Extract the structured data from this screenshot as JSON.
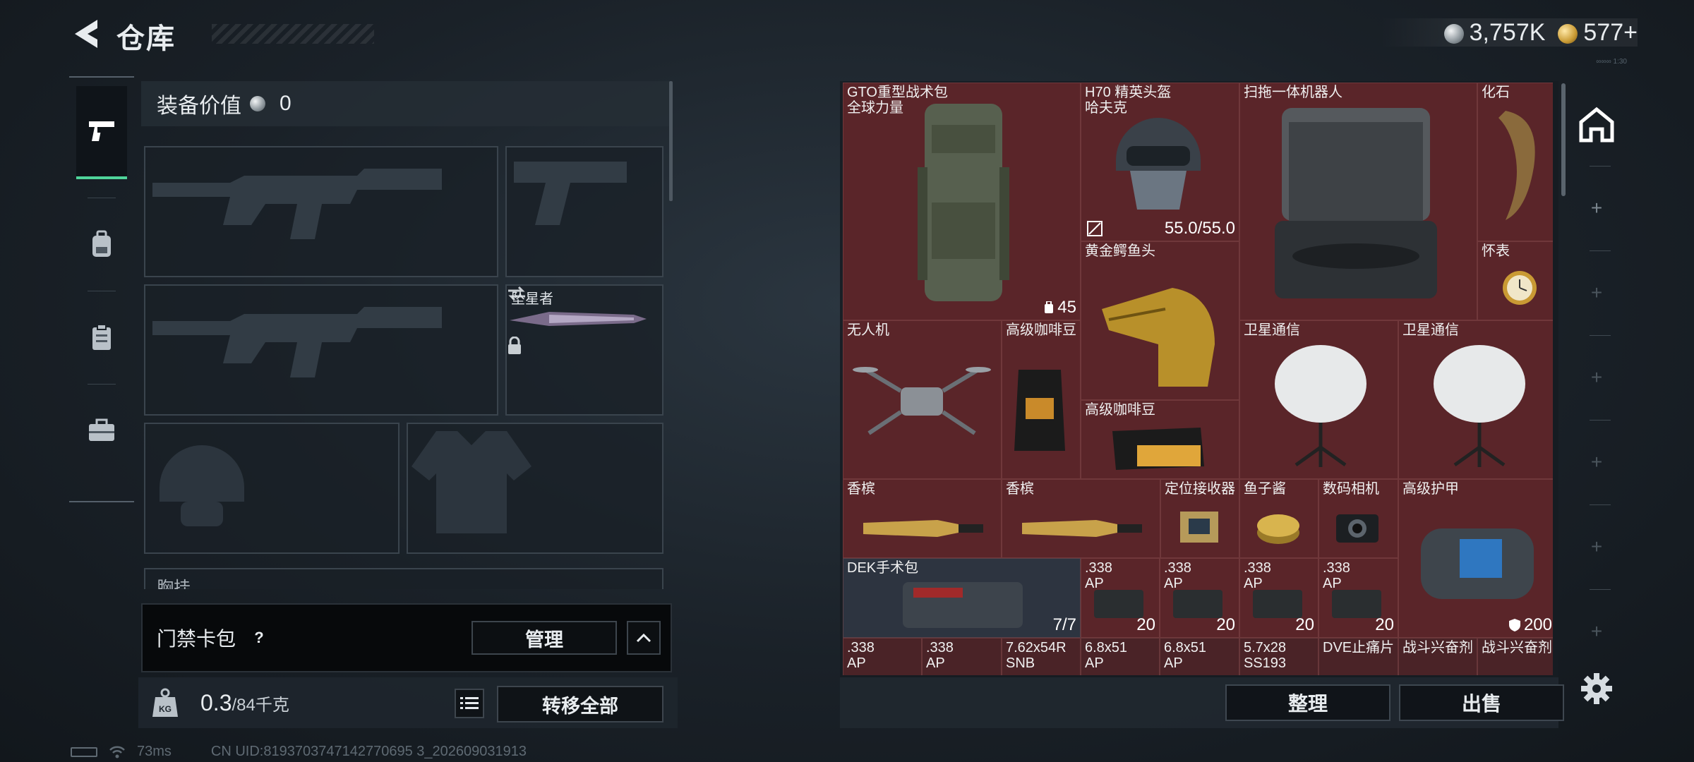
{
  "header": {
    "title": "仓库",
    "currency": [
      {
        "icon": "silver-coin-icon",
        "value": "3,757K"
      },
      {
        "icon": "gold-coin-icon",
        "value": "577+"
      }
    ],
    "tiny_text": "∞∞∞ 1:30"
  },
  "left_nav": [
    {
      "icon": "pistol-icon",
      "active": true
    },
    {
      "icon": "backpack-icon",
      "active": false
    },
    {
      "icon": "clipboard-icon",
      "active": false
    },
    {
      "icon": "briefcase-icon",
      "active": false
    }
  ],
  "equipment": {
    "value_label": "装备价值",
    "value": "0",
    "melee_name": "坠星者",
    "next_section": "胸挂"
  },
  "card_pack": {
    "title": "门禁卡包",
    "help": "?",
    "manage_label": "管理"
  },
  "weight": {
    "current": "0.3",
    "max": "/84千克",
    "icon_text": "KG",
    "transfer_label": "转移全部"
  },
  "status_bar": {
    "ping": "73ms",
    "uid": "CN UID:8193703747142770695 3_202609031913"
  },
  "warehouse_items": [
    {
      "name": "GTO重型战术包\n全球力量",
      "badge": "45"
    },
    {
      "name": "H70 精英头盔\n哈夫克",
      "badge": "55.0/55.0"
    },
    {
      "name": "扫拖一体机器人",
      "badge": ""
    },
    {
      "name": "化石",
      "badge": ""
    },
    {
      "name": "黄金鳄鱼头",
      "badge": ""
    },
    {
      "name": "怀表",
      "badge": ""
    },
    {
      "name": "无人机",
      "badge": ""
    },
    {
      "name": "高级咖啡豆",
      "badge": ""
    },
    {
      "name": "卫星通信",
      "badge": ""
    },
    {
      "name": "卫星通信",
      "badge": ""
    },
    {
      "name": "高级咖啡豆",
      "badge": ""
    },
    {
      "name": "香槟",
      "badge": ""
    },
    {
      "name": "香槟",
      "badge": ""
    },
    {
      "name": "定位接收器",
      "badge": ""
    },
    {
      "name": "鱼子酱",
      "badge": ""
    },
    {
      "name": "数码相机",
      "badge": ""
    },
    {
      "name": "高级护甲",
      "badge": "200"
    },
    {
      "name": "DEK手术包",
      "badge": "7/7"
    },
    {
      "name": ".338\nAP",
      "badge": "20"
    },
    {
      "name": ".338\nAP",
      "badge": "20"
    },
    {
      "name": ".338\nAP",
      "badge": "20"
    },
    {
      "name": ".338\nAP",
      "badge": "20"
    },
    {
      "name": ".338\nAP",
      "badge": ""
    },
    {
      "name": ".338\nAP",
      "badge": ""
    },
    {
      "name": "7.62x54R\nSNB",
      "badge": ""
    },
    {
      "name": "6.8x51\nAP",
      "badge": ""
    },
    {
      "name": "6.8x51\nAP",
      "badge": ""
    },
    {
      "name": "5.7x28\nSS193",
      "badge": ""
    },
    {
      "name": "DVE止痛片",
      "badge": ""
    },
    {
      "name": "战斗兴奋剂",
      "badge": ""
    },
    {
      "name": "战斗兴奋剂",
      "badge": ""
    }
  ],
  "actions": {
    "sort_label": "整理",
    "sell_label": "出售"
  },
  "colors": {
    "item_bg": "#5a2529",
    "item_grey_bg": "#2d3440",
    "active_tab_accent": "#4fd49a"
  }
}
